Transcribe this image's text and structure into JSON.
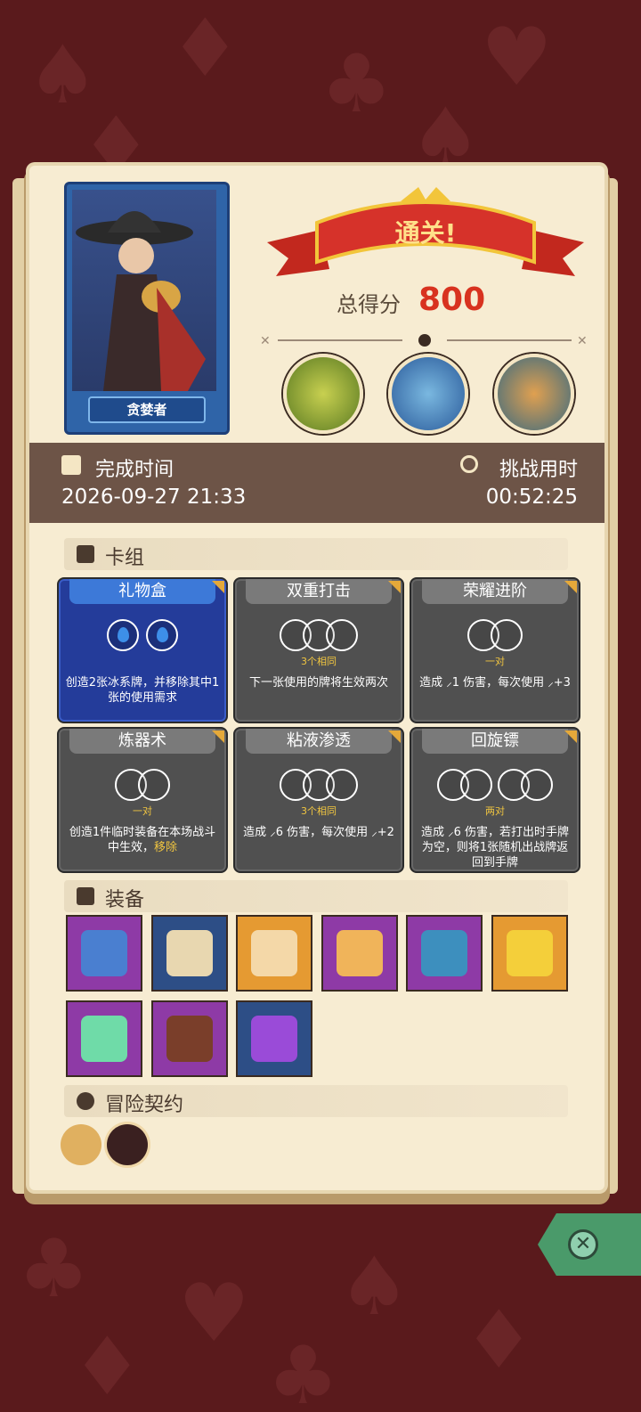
{
  "character": {
    "name": "贪婪者"
  },
  "result": {
    "banner": "通关!",
    "score_label": "总得分",
    "score": "800"
  },
  "info": {
    "finish_label": "完成时间",
    "finish_value": "2026-09-27 21:33",
    "duration_label": "挑战用时",
    "duration_value": "00:52:25"
  },
  "deck": {
    "title": "卡组",
    "cards": [
      {
        "name": "礼物盒",
        "style": "blue",
        "gems": 2,
        "sub": "",
        "desc": "创造2张冰系牌，并移除其中1张的使用需求"
      },
      {
        "name": "双重打击",
        "style": "gray",
        "gems": 3,
        "sub": "3个相同",
        "desc": "下一张使用的牌将生效两次"
      },
      {
        "name": "荣耀进阶",
        "style": "gray",
        "gems": 2,
        "sub": "一对",
        "desc": "造成 ⸝1 伤害，每次使用 ⸝+3"
      },
      {
        "name": "炼器术",
        "style": "gray",
        "gems": 2,
        "sub": "一对",
        "desc": "创造1件临时装备在本场战斗中生效，",
        "highlight": "移除"
      },
      {
        "name": "粘液渗透",
        "style": "gray",
        "gems": 3,
        "sub": "3个相同",
        "desc": "造成 ⸝6 伤害，每次使用 ⸝+2"
      },
      {
        "name": "回旋镖",
        "style": "gray",
        "gems": 4,
        "sub": "两对",
        "desc": "造成 ⸝6 伤害，若打出时手牌为空，则将1张随机出战牌返回到手牌"
      }
    ]
  },
  "equipment": {
    "title": "装备",
    "items": [
      {
        "icon": "tunic-icon",
        "bg": "#8e3aa6",
        "color": "#4a7fd0"
      },
      {
        "icon": "scroll-icon",
        "bg": "#2d4e86",
        "color": "#e8d7b0"
      },
      {
        "icon": "ring-icon",
        "bg": "#e59a32",
        "color": "#f4d8a8"
      },
      {
        "icon": "glove-icon",
        "bg": "#8e3aa6",
        "color": "#f0b45a"
      },
      {
        "icon": "crest-icon",
        "bg": "#8e3aa6",
        "color": "#3d8fbe"
      },
      {
        "icon": "crown-icon",
        "bg": "#e59a32",
        "color": "#f4cf3a"
      },
      {
        "icon": "dice-icon",
        "bg": "#8e3aa6",
        "color": "#6fdba8"
      },
      {
        "icon": "button-icon",
        "bg": "#8e3aa6",
        "color": "#7a3e2a"
      },
      {
        "icon": "potion-icon",
        "bg": "#2d4e86",
        "color": "#9a4bd8"
      }
    ]
  },
  "contract": {
    "title": "冒险契约",
    "items": [
      {
        "icon": "scroll-contract-icon"
      },
      {
        "icon": "pipe-icon"
      }
    ]
  },
  "colors": {
    "accent": "#d8321f",
    "panel": "#f7ecd2",
    "infobar": "#6d5447"
  }
}
